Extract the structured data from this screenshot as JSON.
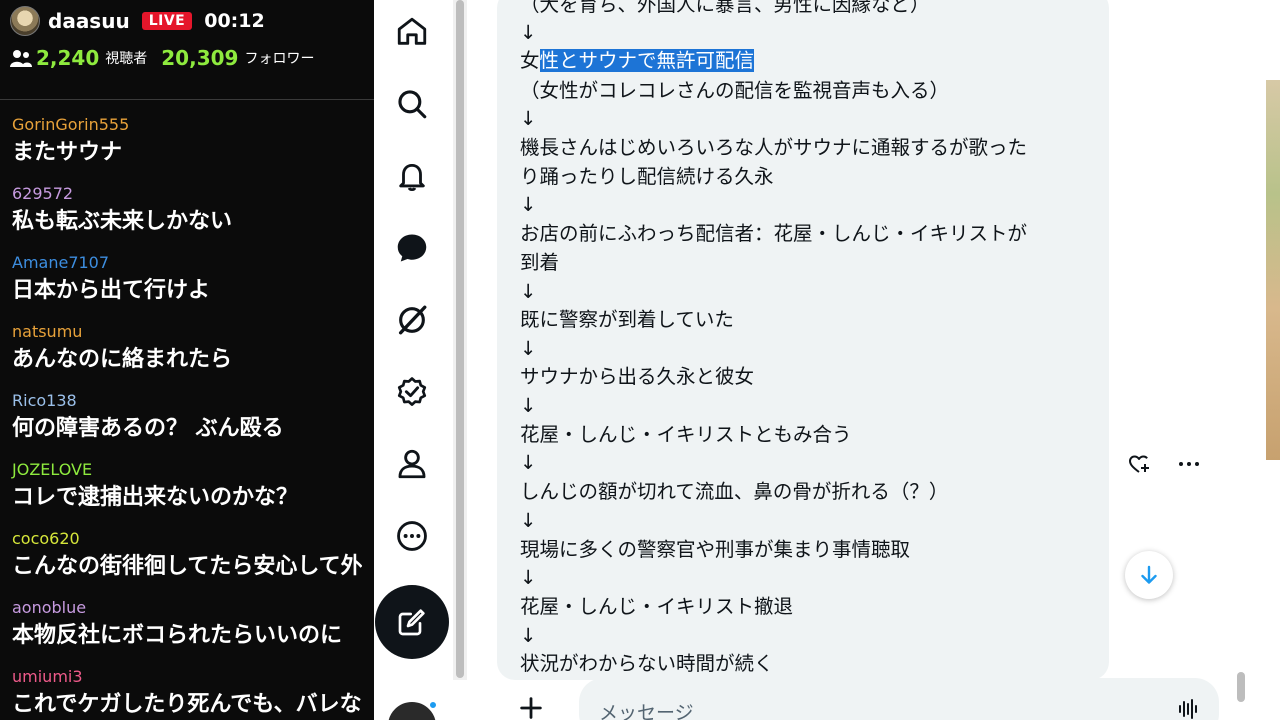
{
  "stream": {
    "streamer_name": "daasuu",
    "live_badge": "LIVE",
    "elapsed_time": "00:12",
    "viewer_count": "2,240",
    "viewer_label": "視聴者",
    "follower_count": "20,309",
    "follower_label": "フォロワー",
    "live_color": "#e5162b",
    "count_color": "#8eea3e"
  },
  "chat_messages": [
    {
      "user": "GorinGorin555",
      "text": "またサウナ",
      "color": "#e8a23a"
    },
    {
      "user": "629572",
      "text": "私も転ぶ未来しかない",
      "color": "#c79be0"
    },
    {
      "user": "Amane7107",
      "text": "日本から出て行けよ",
      "color": "#3d8ee0"
    },
    {
      "user": "natsumu",
      "text": "あんなのに絡まれたら",
      "color": "#e8a23a"
    },
    {
      "user": "Rico138",
      "text": "何の障害あるの？ ぶん殴る",
      "color": "#9bc0ea"
    },
    {
      "user": "JOZELOVE",
      "text": "コレで逮捕出来ないのかな？",
      "color": "#8eea3e"
    },
    {
      "user": "coco620",
      "text": "こんなの街徘徊してたら安心して外",
      "color": "#d6e63a"
    },
    {
      "user": "aonoblue",
      "text": "本物反社にボコられたらいいのに",
      "color": "#c79be0"
    },
    {
      "user": "umiumi3",
      "text": "これでケガしたり死んでも、バレな",
      "color": "#ee5a8a"
    }
  ],
  "nav_icons": [
    "home-icon",
    "search-icon",
    "notifications-icon",
    "messages-icon",
    "grok-icon",
    "verified-icon",
    "profile-icon",
    "more-icon"
  ],
  "dm": {
    "top_partial": "（犬を育ち、外国人に暴言、男性に因縁など）",
    "hl_prefix": "女",
    "hl_text": "性とサウナで無許可配信",
    "lines": [
      "↓",
      "（女性がコレコレさんの配信を監視音声も入る）",
      "↓",
      "機長さんはじめいろいろな人がサウナに通報するが歌った",
      "り踊ったりし配信続ける久永",
      "↓",
      "お店の前にふわっち配信者：花屋・しんじ・イキリストが",
      "到着",
      "↓",
      "既に警察が到着していた",
      "↓",
      "サウナから出る久永と彼女",
      "↓",
      "花屋・しんじ・イキリストともみ合う",
      "↓",
      "しんじの額が切れて流血、鼻の骨が折れる（？）",
      "↓",
      "現場に多くの警察官や刑事が集まり事情聴取",
      "↓",
      "花屋・しんじ・イキリスト撤退",
      "↓",
      "状況がわからない時間が続く"
    ],
    "message_placeholder": "メッセージ",
    "highlight_color": "#1d74d6"
  }
}
